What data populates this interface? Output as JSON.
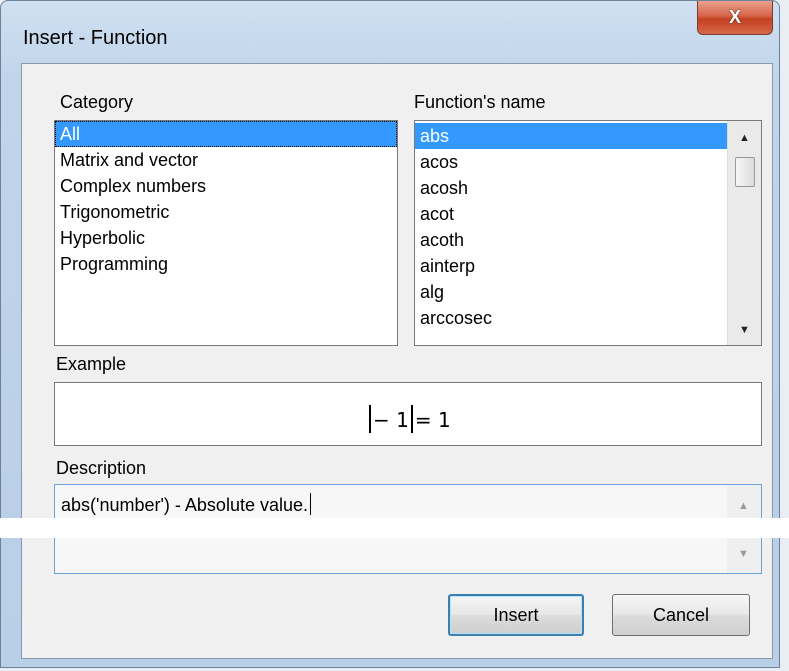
{
  "window": {
    "title": "Insert - Function",
    "close_glyph": "X"
  },
  "category": {
    "label": "Category",
    "items": [
      "All",
      "Matrix and vector",
      "Complex numbers",
      "Trigonometric",
      "Hyperbolic",
      "Programming"
    ],
    "selected": "All"
  },
  "functions": {
    "label": "Function's name",
    "items": [
      "abs",
      "acos",
      "acosh",
      "acot",
      "acoth",
      "ainterp",
      "alg",
      "arccosec"
    ],
    "selected": "abs"
  },
  "example": {
    "label": "Example",
    "minus": "−",
    "one": "1",
    "equals_result": "= 1"
  },
  "description": {
    "label": "Description",
    "text": "abs('number') - Absolute value."
  },
  "buttons": {
    "insert": "Insert",
    "cancel": "Cancel"
  },
  "colors": {
    "selection": "#3399ff",
    "close_button": "#c2401f",
    "frame": "#b9cfe7"
  },
  "icons": {
    "scroll_up": "up-arrow-icon",
    "scroll_down": "down-arrow-icon",
    "close": "close-icon"
  }
}
